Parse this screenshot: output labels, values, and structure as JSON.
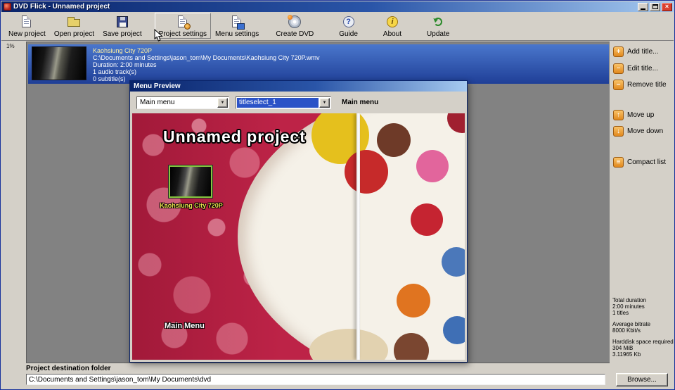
{
  "window": {
    "title": "DVD Flick - Unnamed project"
  },
  "icons": {
    "close": "×",
    "dropdown": "▼",
    "add": "+",
    "edit": "···",
    "remove": "−",
    "up": "↑",
    "down": "↓",
    "compact": "≡",
    "guide": "?",
    "about": "i"
  },
  "toolbar": {
    "buttons": [
      {
        "label": "New project",
        "icon": "new-project-icon"
      },
      {
        "label": "Open project",
        "icon": "open-project-icon"
      },
      {
        "label": "Save project",
        "icon": "save-project-icon"
      },
      {
        "label": "Project settings",
        "icon": "project-settings-icon"
      },
      {
        "label": "Menu settings",
        "icon": "menu-settings-icon"
      },
      {
        "label": "Create DVD",
        "icon": "create-dvd-icon"
      },
      {
        "label": "Guide",
        "icon": "guide-icon"
      },
      {
        "label": "About",
        "icon": "about-icon"
      },
      {
        "label": "Update",
        "icon": "update-icon"
      }
    ]
  },
  "title_list": {
    "gutter_label": "1%",
    "items": [
      {
        "name": "Kaohsiung City 720P",
        "path": "C:\\Documents and Settings\\jason_tom\\My Documents\\Kaohsiung City 720P.wmv",
        "duration": "Duration: 2:00 minutes",
        "audio": "1 audio track(s)",
        "subtitles": "0 subtitle(s)"
      }
    ]
  },
  "sidebar": {
    "buttons": [
      {
        "label": "Add title...",
        "icon": "add-title-icon"
      },
      {
        "label": "Edit title...",
        "icon": "edit-title-icon"
      },
      {
        "label": "Remove title",
        "icon": "remove-title-icon"
      },
      {
        "label": "Move up",
        "icon": "move-up-icon"
      },
      {
        "label": "Move down",
        "icon": "move-down-icon"
      },
      {
        "label": "Compact list",
        "icon": "compact-list-icon"
      }
    ],
    "stats": [
      {
        "label": "Total duration",
        "lines": [
          "2:00 minutes",
          "1 titles"
        ]
      },
      {
        "label": "Average bitrate",
        "lines": [
          "8000 Kbit/s"
        ]
      },
      {
        "label": "Harddisk space required",
        "lines": [
          "304 MiB",
          "3.11965 Kb"
        ]
      }
    ]
  },
  "dialog": {
    "title": "Menu Preview",
    "menu_select_value": "Main menu",
    "item_select_value": "titleselect_1",
    "caption": "Main menu",
    "preview": {
      "project_title": "Unnamed project",
      "thumbnail_label": "Kaohsiung City 720P",
      "menu_label": "Main Menu"
    }
  },
  "bottom": {
    "label": "Project destination folder",
    "path": "C:\\Documents and Settings\\jason_tom\\My Documents\\dvd",
    "browse_label": "Browse..."
  }
}
